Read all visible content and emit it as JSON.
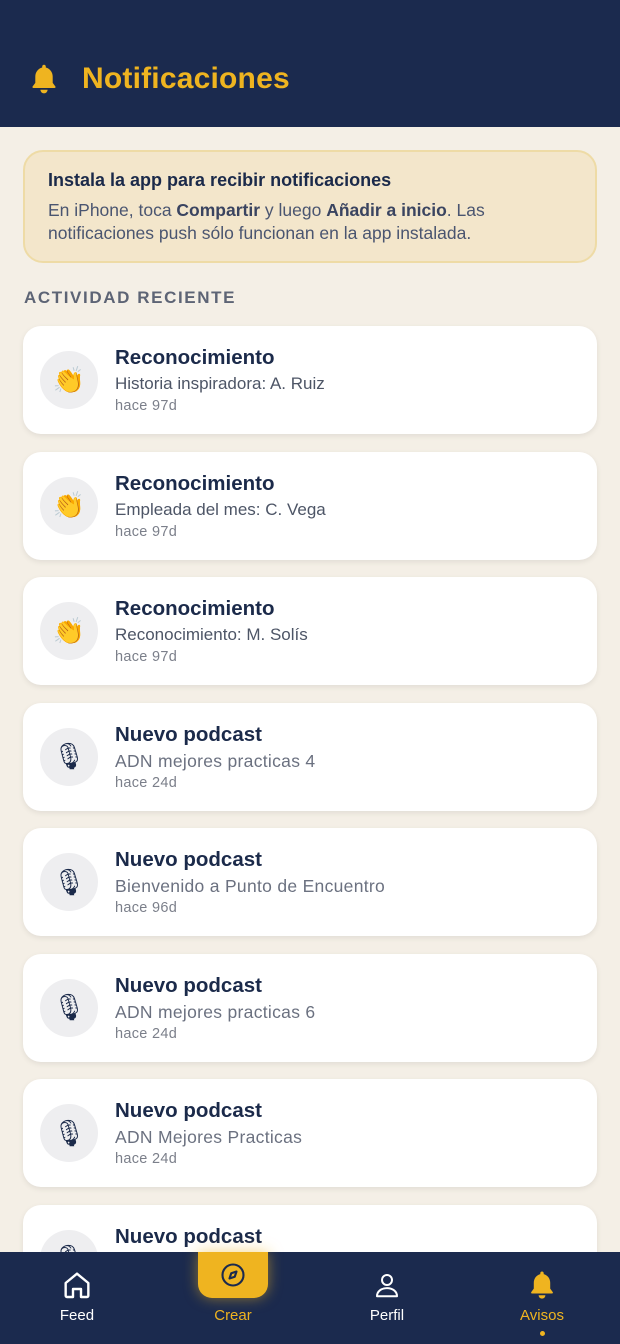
{
  "header": {
    "title": "Notificaciones",
    "icon": "bell-icon",
    "accent": "#efb420",
    "background": "#1b2a4e"
  },
  "banner": {
    "title": "Instala la app para recibir notificaciones",
    "text_pre": "En iPhone, toca ",
    "text_bold1": "Compartir",
    "text_mid": " y luego ",
    "text_bold2": "Añadir a inicio",
    "text_post": ". Las notificaciones push sólo funcionan en la app instalada."
  },
  "section": {
    "title": "ACTIVIDAD RECIENTE"
  },
  "notifications": [
    {
      "type": "recognition",
      "icon": "clapping-hands-icon",
      "emoji": "👏",
      "title": "Reconocimiento",
      "subtitle": "Historia inspiradora: A. Ruiz",
      "time": "hace 97d"
    },
    {
      "type": "recognition",
      "icon": "clapping-hands-icon",
      "emoji": "👏",
      "title": "Reconocimiento",
      "subtitle": "Empleada del mes: C. Vega",
      "time": "hace 97d"
    },
    {
      "type": "recognition",
      "icon": "clapping-hands-icon",
      "emoji": "👏",
      "title": "Reconocimiento",
      "subtitle": "Reconocimiento: M. Solís",
      "time": "hace 97d"
    },
    {
      "type": "podcast",
      "icon": "microphone-icon",
      "emoji": "🎙",
      "title": "Nuevo podcast",
      "subtitle": "ADN mejores practicas 4",
      "time": "hace 24d"
    },
    {
      "type": "podcast",
      "icon": "microphone-icon",
      "emoji": "🎙",
      "title": "Nuevo podcast",
      "subtitle": "Bienvenido a Punto de Encuentro",
      "time": "hace 96d"
    },
    {
      "type": "podcast",
      "icon": "microphone-icon",
      "emoji": "🎙",
      "title": "Nuevo podcast",
      "subtitle": "ADN mejores practicas 6",
      "time": "hace 24d"
    },
    {
      "type": "podcast",
      "icon": "microphone-icon",
      "emoji": "🎙",
      "title": "Nuevo podcast",
      "subtitle": "ADN Mejores Practicas",
      "time": "hace 24d"
    },
    {
      "type": "podcast",
      "icon": "microphone-icon",
      "emoji": "🎙",
      "title": "Nuevo podcast",
      "subtitle": "",
      "time": ""
    }
  ],
  "nav": {
    "items": [
      {
        "label": "Feed",
        "icon": "home-icon"
      },
      {
        "label": "Crear",
        "icon": "compass-icon"
      },
      {
        "label": "Perfil",
        "icon": "user-icon"
      },
      {
        "label": "Avisos",
        "icon": "bell-icon",
        "active": true
      }
    ]
  }
}
